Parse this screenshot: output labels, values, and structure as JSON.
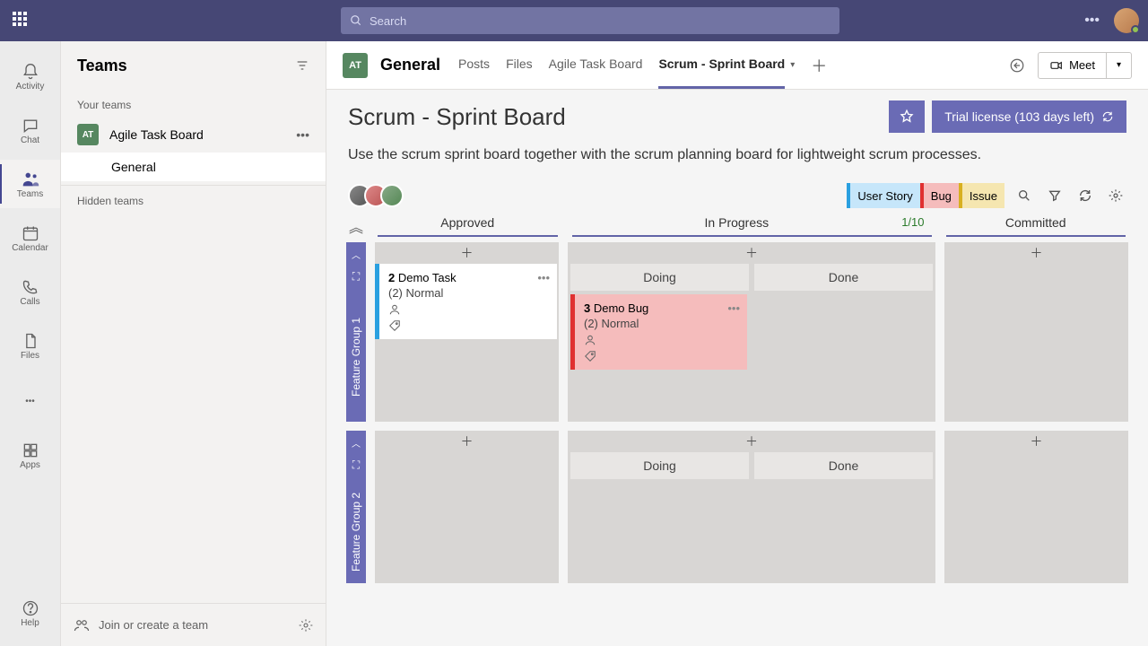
{
  "search": {
    "placeholder": "Search"
  },
  "rail": {
    "activity": "Activity",
    "chat": "Chat",
    "teams": "Teams",
    "calendar": "Calendar",
    "calls": "Calls",
    "files": "Files",
    "apps": "Apps",
    "help": "Help"
  },
  "teamsPanel": {
    "title": "Teams",
    "yourTeams": "Your teams",
    "team": {
      "abbr": "AT",
      "name": "Agile Task Board"
    },
    "channel": "General",
    "hiddenTeams": "Hidden teams",
    "joinCreate": "Join or create a team"
  },
  "channelBar": {
    "abbr": "AT",
    "name": "General",
    "tabs": [
      "Posts",
      "Files",
      "Agile Task Board",
      "Scrum - Sprint Board"
    ],
    "activeTab": 3,
    "meet": "Meet"
  },
  "board": {
    "title": "Scrum - Sprint Board",
    "description": "Use the scrum sprint board together with the scrum planning board for lightweight scrum processes.",
    "trial": "Trial license (103 days left)",
    "filters": {
      "userStory": "User Story",
      "bug": "Bug",
      "issue": "Issue"
    },
    "columns": {
      "approved": "Approved",
      "inProgress": "In Progress",
      "inProgressCount": "1/10",
      "committed": "Committed",
      "doing": "Doing",
      "done": "Done"
    },
    "lanes": {
      "g1": "Feature Group 1",
      "g2": "Feature Group 2"
    },
    "cards": {
      "task": {
        "id": "2",
        "title": "Demo Task",
        "priority": "(2) Normal"
      },
      "bug": {
        "id": "3",
        "title": "Demo Bug",
        "priority": "(2) Normal"
      }
    }
  }
}
